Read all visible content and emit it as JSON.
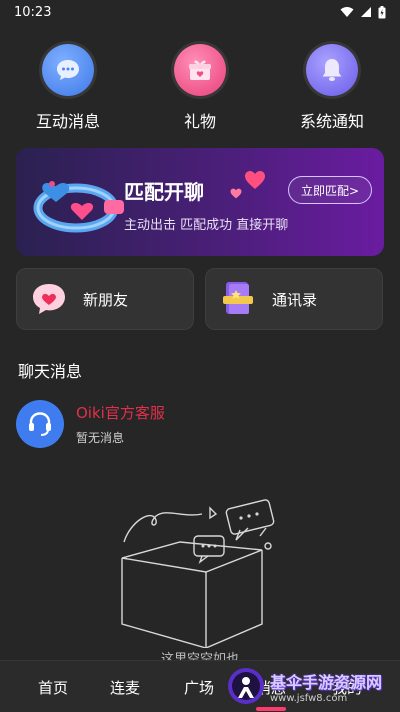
{
  "status_bar": {
    "time": "10:23"
  },
  "top_actions": [
    {
      "label": "互动消息",
      "icon": "chat-bubble-icon",
      "color": "#4a86ee"
    },
    {
      "label": "礼物",
      "icon": "gift-icon",
      "color": "#ee4f86"
    },
    {
      "label": "系统通知",
      "icon": "bell-icon",
      "color": "#7a6cf2"
    }
  ],
  "match_banner": {
    "title": "匹配开聊",
    "subtitle": "主动出击 匹配成功 直接开聊",
    "button_label": "立即匹配>"
  },
  "cards": [
    {
      "label": "新朋友",
      "icon": "heart-bubble-icon"
    },
    {
      "label": "通讯录",
      "icon": "contact-book-icon"
    }
  ],
  "chat_section": {
    "title": "聊天消息",
    "items": [
      {
        "name": "Oiki官方客服",
        "preview": "暂无消息"
      }
    ]
  },
  "empty_state": {
    "text": "这里空空如也"
  },
  "bottom_nav": {
    "items": [
      "首页",
      "连麦",
      "广场",
      "消息",
      "我的"
    ],
    "active_index": 3,
    "accent": "#ff3a6e"
  },
  "watermark": {
    "title": "基伞手游资源网",
    "url": "www.jsfw8.com"
  }
}
